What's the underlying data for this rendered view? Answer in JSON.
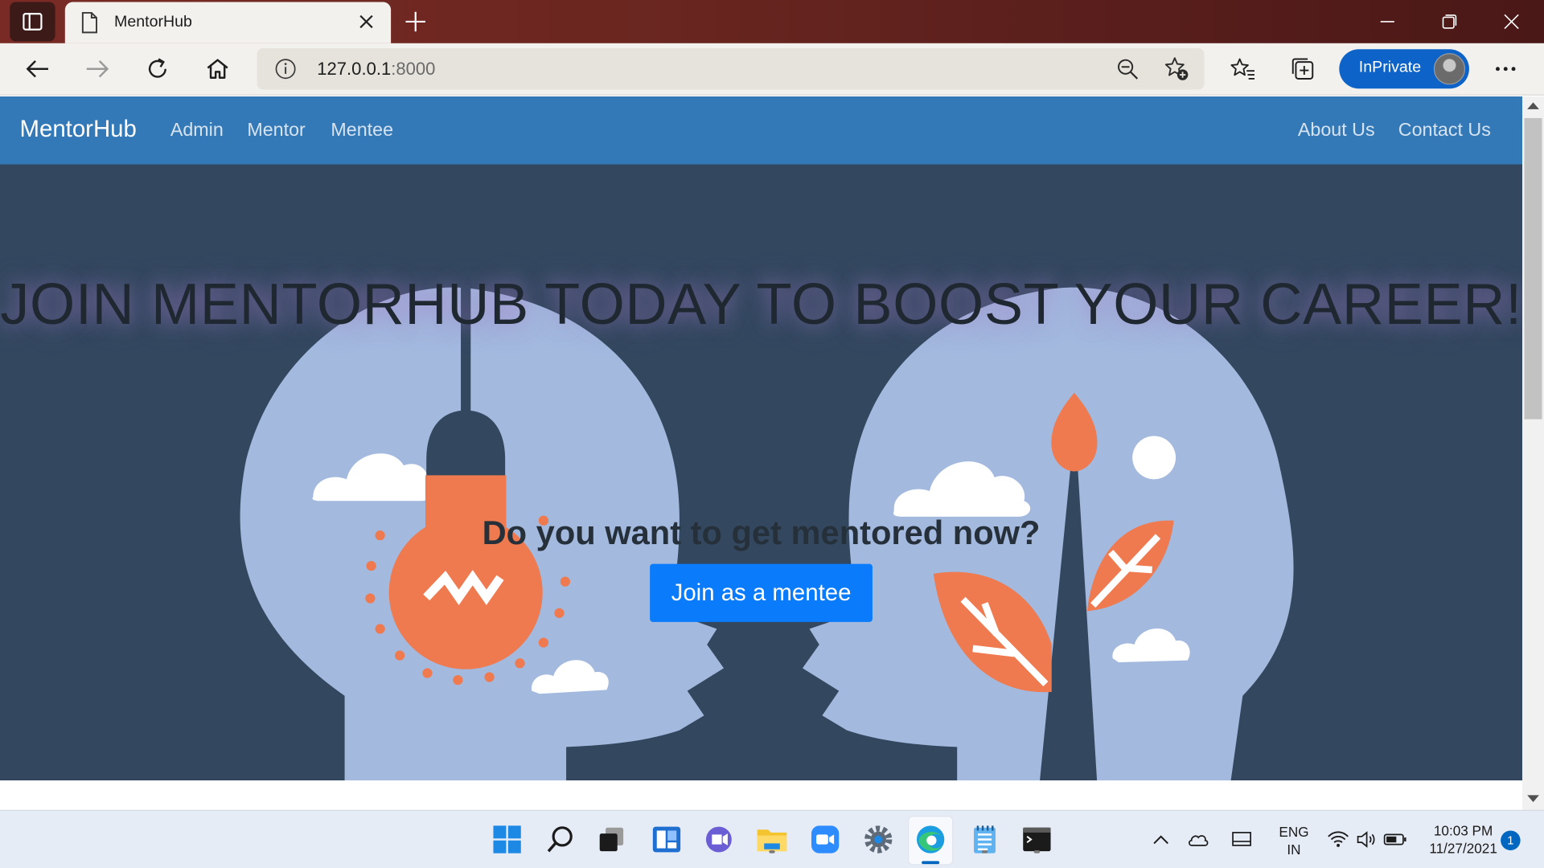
{
  "browser": {
    "tab_title": "MentorHub",
    "url_host": "127.0.0.1",
    "url_port": ":8000",
    "inprivate_label": "InPrivate"
  },
  "site": {
    "brand": "MentorHub",
    "nav_left": [
      "Admin",
      "Mentor",
      "Mentee"
    ],
    "nav_right": [
      "About Us",
      "Contact Us"
    ],
    "hero_title": "JOIN MENTORHUB TODAY TO BOOST YOUR CAREER!",
    "hero_question": "Do you want to get mentored now?",
    "cta_label": "Join as a mentee",
    "colors": {
      "navbar": "#3479b7",
      "hero_background": "#33485f",
      "head_silhouette": "#a3b9de",
      "accent_orange": "#ef7a4f",
      "cta_button": "#0a7bfb"
    }
  },
  "taskbar": {
    "apps": [
      "start-icon",
      "search-icon",
      "task-view-icon",
      "widgets-icon",
      "teams-chat-icon",
      "file-explorer-icon",
      "zoom-icon",
      "settings-icon",
      "edge-icon",
      "notepad-icon",
      "terminal-icon"
    ],
    "language_line1": "ENG",
    "language_line2": "IN",
    "time": "10:03 PM",
    "date": "11/27/2021",
    "notification_count": "1"
  }
}
